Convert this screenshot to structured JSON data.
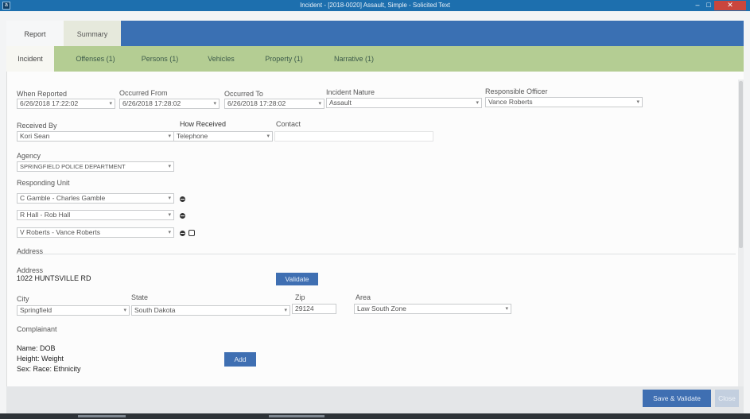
{
  "window": {
    "title": "Incident - [2018-0020] Assault, Simple - Solicited Text",
    "icon_letter": "a",
    "controls": {
      "minimize": "‒",
      "maximize": "□",
      "close": "✕"
    }
  },
  "top_tabs": {
    "report": "Report",
    "summary": "Summary"
  },
  "sub_tabs": {
    "incident": "Incident",
    "offenses": "Offenses (1)",
    "persons": "Persons (1)",
    "vehicles": "Vehicles",
    "property": "Property (1)",
    "narrative": "Narrative (1)"
  },
  "form": {
    "when_reported": {
      "label": "When Reported",
      "value": "6/26/2018 17:22:02"
    },
    "occurred_from": {
      "label": "Occurred From",
      "value": "6/26/2018 17:28:02"
    },
    "occurred_to": {
      "label": "Occurred To",
      "value": "6/26/2018 17:28:02"
    },
    "incident_nature": {
      "label": "Incident Nature",
      "value": "Assault"
    },
    "responsible_officer": {
      "label": "Responsible Officer",
      "value": "Vance Roberts"
    },
    "received_by": {
      "label": "Received By",
      "value": "Kori Sean"
    },
    "how_received": {
      "label": "How Received",
      "value": "Telephone"
    },
    "contact": {
      "label": "Contact",
      "value": ""
    },
    "agency": {
      "label": "Agency",
      "value": "SPRINGFIELD POLICE DEPARTMENT"
    },
    "responding_unit": {
      "label": "Responding Unit",
      "units": [
        "C Gamble - Charles Gamble",
        "R Hall - Rob Hall",
        "V Roberts - Vance Roberts"
      ]
    },
    "address_section": "Address",
    "address": {
      "label": "Address",
      "value": "1022 HUNTSVILLE RD",
      "validate": "Validate"
    },
    "city": {
      "label": "City",
      "value": "Springfield"
    },
    "state": {
      "label": "State",
      "value": "South Dakota"
    },
    "zip": {
      "label": "Zip",
      "value": "29124"
    },
    "area": {
      "label": "Area",
      "value": "Law South Zone"
    },
    "complainant": {
      "label": "Complainant",
      "name": "Name: DOB",
      "height": "Height: Weight",
      "sex": "Sex: Race: Ethnicity",
      "add": "Add"
    }
  },
  "footer": {
    "save_validate": "Save & Validate",
    "close": "Close"
  }
}
